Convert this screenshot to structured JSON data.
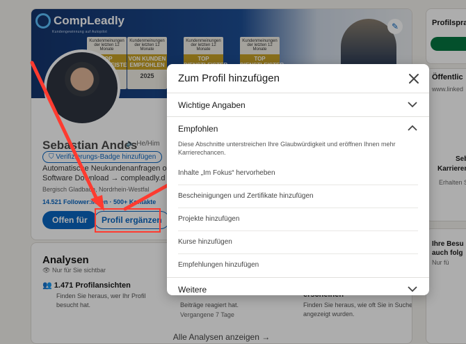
{
  "banner": {
    "logo": "CompLeadly",
    "logo_tagline": "Kundengewinnung auf Autopilot",
    "badges": [
      {
        "caption": "Kundenmeinungen der letzten 12 Monate",
        "label": "TOP DIENSTLEISTER",
        "year": ""
      },
      {
        "caption": "Kundenmeinungen der letzten 12 Monate",
        "label": "VON KUNDEN EMPFOHLEN",
        "year": "2025"
      },
      {
        "caption": "Kundenmeinungen der letzten 12 Monate",
        "label": "TOP DIENSTLEISTER",
        "year": "2025"
      },
      {
        "caption": "Kundenmeinungen der letzten 12 Monate",
        "label": "TOP DIENSTLEISTER",
        "year": "2025"
      }
    ]
  },
  "profile": {
    "name": "Sebastian Andes",
    "pronouns": "He/Him",
    "verify_label": "Verifizierungs-Badge hinzufügen",
    "headline": "Automatische Neukundenanfragen oh",
    "headline2": "Software Download → compleadly.d",
    "location": "Bergisch Gladbach, Nordrhein-Westfal",
    "stats": "14.521 Follower:innen · 500+ Kontakte",
    "open_label": "Offen für",
    "complete_label": "Profil ergänzen"
  },
  "analytics": {
    "title": "Analysen",
    "private": "Nur für Sie sichtbar",
    "items": [
      {
        "title": "1.471 Profilansichten",
        "desc": "Finden Sie heraus, wer Ihr Profil besucht hat.",
        "meta": ""
      },
      {
        "title": "",
        "desc": "Beiträge reagiert hat.",
        "meta": "Vergangene 7 Tage"
      },
      {
        "title": "erscheinen",
        "desc": "Finden Sie heraus, wie oft Sie in Suchen angezeigt wurden.",
        "meta": ""
      }
    ],
    "show_all": "Alle Analysen anzeigen →"
  },
  "sidebar": {
    "lang_title": "Profilspra",
    "url_title": "Öffentlic",
    "url_value": "www.linked",
    "people_title": "Ihre Besu",
    "people_title2": "auch folg",
    "people_private": "Nur fü",
    "seb": "Seb",
    "karriere": "Karrieren",
    "erhalten": "Erhalten S"
  },
  "modal": {
    "title": "Zum Profil hinzufügen",
    "sections": {
      "core": {
        "label": "Wichtige Angaben"
      },
      "recommended": {
        "label": "Empfohlen",
        "description": "Diese Abschnitte unterstreichen Ihre Glaubwürdigkeit und eröffnen Ihnen mehr Karrierechancen.",
        "items": [
          "Inhalte „Im Fokus“ hervorheben",
          "Bescheinigungen und Zertifikate hinzufügen",
          "Projekte hinzufügen",
          "Kurse hinzufügen",
          "Empfehlungen hinzufügen"
        ]
      },
      "more": {
        "label": "Weitere"
      }
    }
  },
  "colors": {
    "accent": "#0a66c2",
    "annotation": "#ff3b30"
  }
}
